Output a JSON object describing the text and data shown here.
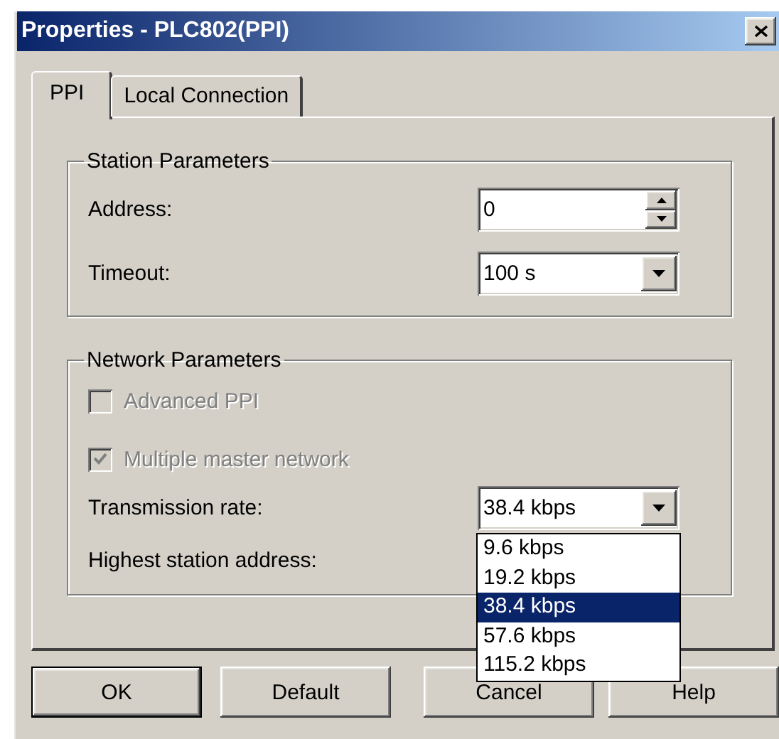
{
  "window": {
    "title": "Properties - PLC802(PPI)"
  },
  "tabs": [
    {
      "label": "PPI",
      "selected": true
    },
    {
      "label": "Local Connection",
      "selected": false
    }
  ],
  "station_parameters": {
    "title": "Station Parameters",
    "address": {
      "label": "Address:",
      "value": "0"
    },
    "timeout": {
      "label": "Timeout:",
      "value": "100 s"
    }
  },
  "network_parameters": {
    "title": "Network Parameters",
    "options": [
      {
        "label": "Advanced PPI",
        "checked": false,
        "disabled": true
      },
      {
        "label": "Multiple master network",
        "checked": true,
        "disabled": true
      }
    ],
    "transmission_rate": {
      "label": "Transmission rate:",
      "value": "38.4 kbps",
      "expanded": true,
      "options": [
        {
          "label": "9.6 kbps",
          "selected": false
        },
        {
          "label": "19.2 kbps",
          "selected": false
        },
        {
          "label": "38.4 kbps",
          "selected": true
        },
        {
          "label": "57.6 kbps",
          "selected": false
        },
        {
          "label": "115.2 kbps",
          "selected": false
        }
      ]
    },
    "highest_station_address": {
      "label": "Highest station address:"
    }
  },
  "buttons": [
    {
      "label": "OK",
      "default": true
    },
    {
      "label": "Default",
      "default": false
    },
    {
      "label": "Cancel",
      "default": false
    },
    {
      "label": "Help",
      "default": false
    }
  ]
}
